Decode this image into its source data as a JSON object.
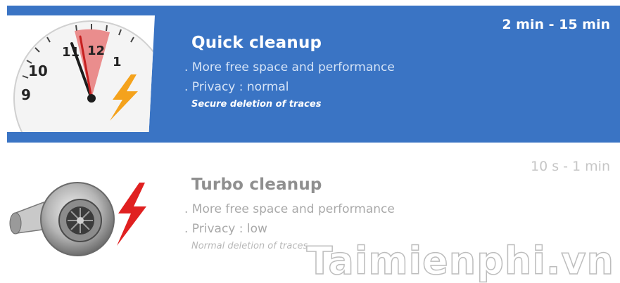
{
  "options": [
    {
      "title": "Quick cleanup",
      "line1": ". More free space and performance",
      "line2": ". Privacy : normal",
      "note": "Secure deletion of traces",
      "duration": "2 min - 15 min",
      "selected": true,
      "icon": "stopwatch-lightning-icon"
    },
    {
      "title": "Turbo cleanup",
      "line1": ". More free space and performance",
      "line2": ". Privacy : low",
      "note": "Normal deletion of traces",
      "duration": "10 s - 1 min",
      "selected": false,
      "icon": "turbocharger-lightning-icon"
    }
  ],
  "watermark": "Taimienphi.vn",
  "colors": {
    "selected_bg": "#3a74c4",
    "lightning_orange": "#f4a21c",
    "lightning_red": "#e02020"
  }
}
